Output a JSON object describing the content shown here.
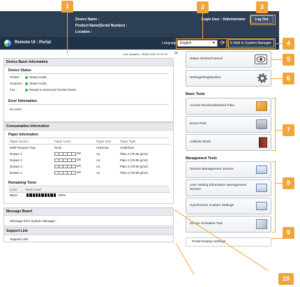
{
  "header": {
    "device_name_label": "Device Name :",
    "product_name_label": "Product Name(Serial Number) :",
    "location_label": "Location :",
    "login_user_label": "Login User :",
    "login_user_value": "Administrator",
    "logout_label": "Log Out"
  },
  "titlebar": {
    "title": "Remote UI : Portal",
    "language_label": "Language:",
    "language_value": "English",
    "mail_button_label": "E-Mail to System Manager"
  },
  "last_updated": "Last Updated : 06/06 2022 10:47:43",
  "device_basic": {
    "title": "Device Basic Information",
    "status_title": "Device Status",
    "status_rows": [
      {
        "key": "Printer :",
        "value": "Sleep mode."
      },
      {
        "key": "Scanner :",
        "value": "Sleep mode."
      },
      {
        "key": "Fax :",
        "value": "Ready to send and receive faxes."
      }
    ],
    "error_title": "Error Information",
    "error_value": "No error."
  },
  "consumables": {
    "title": "Consumables Information",
    "paper_title": "Paper Information",
    "columns": [
      "Paper Source",
      "Paper Level",
      "Paper Size",
      "Paper Type"
    ],
    "rows": [
      {
        "source": "Multi-Purpose Tray",
        "level": "None",
        "size": "Unknown",
        "type": "Undefined",
        "bar": false
      },
      {
        "source": "Drawer 1",
        "level": "OK",
        "size": "A4",
        "type": "Plain 2 (75-90 g/m2)",
        "bar": true
      },
      {
        "source": "Drawer 2",
        "level": "OK",
        "size": "A4",
        "type": "Plain 2 (75-90 g/m2)",
        "bar": true
      },
      {
        "source": "Drawer 3",
        "level": "OK",
        "size": "A4",
        "type": "Plain 2 (75-90 g/m2)",
        "bar": true
      },
      {
        "source": "Drawer 4",
        "level": "OK",
        "size": "A4",
        "type": "Plain 2 (75-90 g/m2)",
        "bar": true
      }
    ],
    "toner_title": "Remaining Toner",
    "toner_columns": [
      "Color",
      "Toner Level"
    ],
    "toner_row": {
      "color": "Black :",
      "percent": "100%",
      "level_fraction": 1.0
    }
  },
  "message_board": {
    "title": "Message Board",
    "text": "Message from System Manager :"
  },
  "support_link": {
    "title": "Support Link",
    "text": "Support Link :"
  },
  "right": {
    "status_monitor_label": "Status Monitor/Cancel",
    "settings_label": "Settings/Registration",
    "basic_tools_title": "Basic Tools",
    "basic_tools": [
      {
        "label": "Access Received/Stored Files",
        "icon": "box-icon"
      },
      {
        "label": "Direct Print",
        "icon": "printer-icon"
      },
      {
        "label": "Address Book",
        "icon": "book-icon"
      }
    ],
    "management_tools_title": "Management Tools",
    "management_tools": [
      {
        "label": "Service Management Service",
        "icon": "monitor-icon"
      },
      {
        "label": "User Setting Information Management Service",
        "icon": "monitor-icon"
      },
      {
        "label": "Synchronize Custom Settings",
        "icon": "monitor-icon"
      },
      {
        "label": "Device Activation Tool",
        "icon": "tool-icon"
      }
    ],
    "portal_display_settings_label": "Portal Display Settings"
  },
  "callouts": [
    "1",
    "2",
    "3",
    "4",
    "5",
    "6",
    "7",
    "8",
    "9",
    "10"
  ],
  "colors": {
    "accent": "#f0a53a",
    "header": "#2d3f55",
    "status_ok": "#39b54a"
  }
}
